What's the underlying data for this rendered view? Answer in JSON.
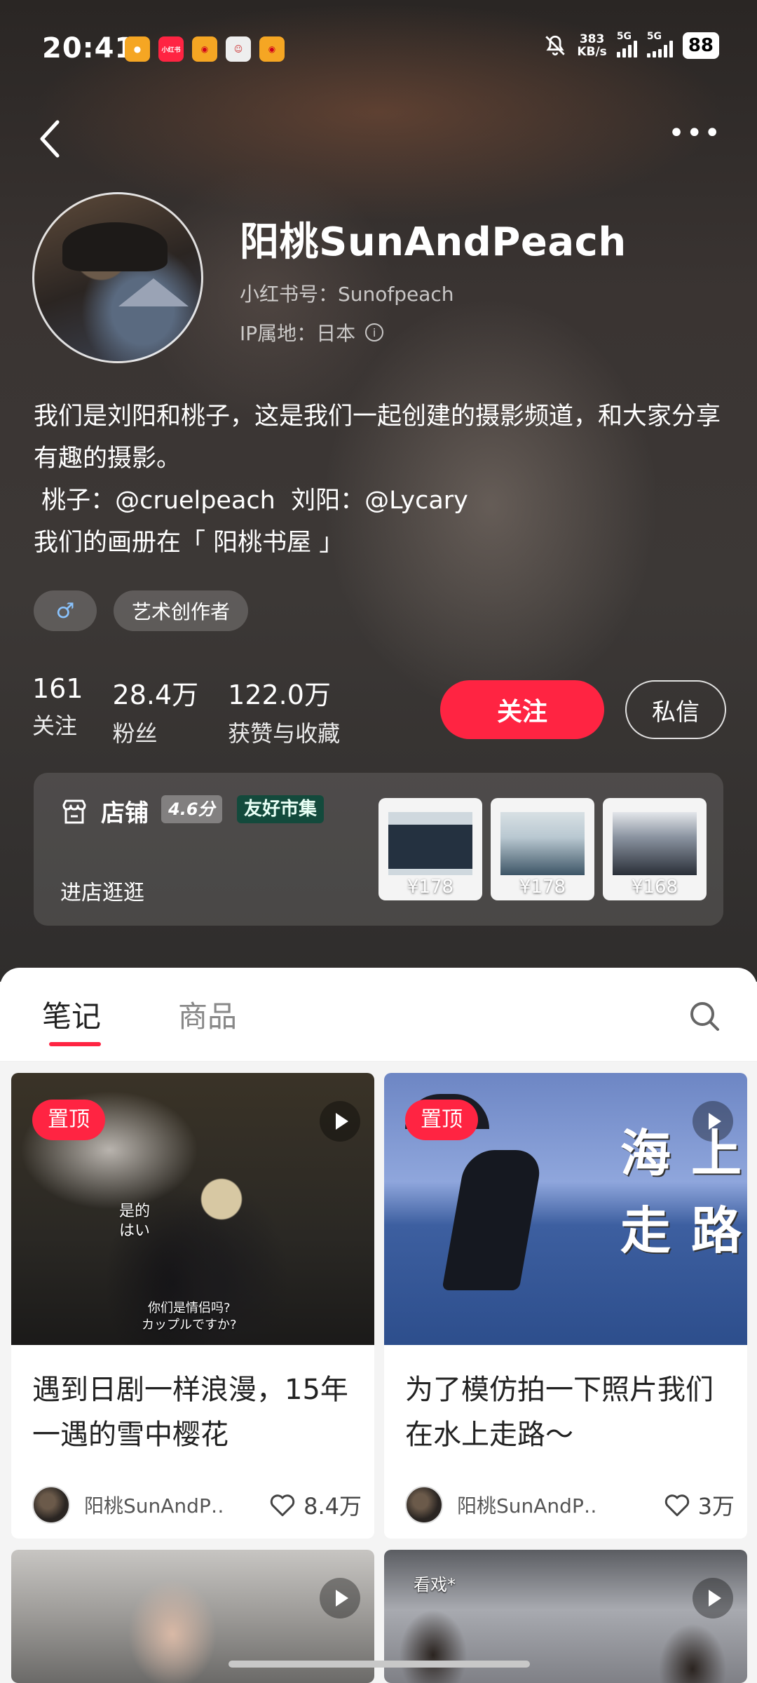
{
  "status_bar": {
    "time": "20:41",
    "net_speed_value": "383",
    "net_speed_unit": "KB/s",
    "sim1": "5G",
    "sim2": "5G",
    "battery": "88",
    "app_icons": [
      "notify-yellow-icon",
      "xiaohongshu-icon",
      "weibo-icon",
      "avatar-app-icon",
      "weibo-alt-icon"
    ],
    "xhs_label": "小红书"
  },
  "nav": {
    "back_icon": "back-chevron-icon",
    "more_icon": "more-dots-icon"
  },
  "profile": {
    "name": "阳桃SunAndPeach",
    "red_id": "小红书号：Sunofpeach",
    "ip": "IP属地：日本",
    "bio_lines": [
      "我们是刘阳和桃子，这是我们一起创建的摄影频道，和大家分享有趣的摄影。",
      " 桃子：@cruelpeach  刘阳：@Lycary",
      "我们的画册在「 阳桃书屋 」"
    ],
    "gender_symbol": "♂",
    "tag": "艺术创作者"
  },
  "stats": [
    {
      "num": "161",
      "label": "关注"
    },
    {
      "num": "28.4万",
      "label": "粉丝"
    },
    {
      "num": "122.0万",
      "label": "获赞与收藏"
    }
  ],
  "actions": {
    "follow": "关注",
    "message": "私信"
  },
  "shop": {
    "title": "店铺",
    "score": "4.6分",
    "badge": "友好市集",
    "link": "进店逛逛",
    "items": [
      {
        "price": "¥178"
      },
      {
        "price": "¥178"
      },
      {
        "price": "¥168"
      }
    ]
  },
  "tabs": {
    "notes": "笔记",
    "goods": "商品"
  },
  "cards": [
    {
      "pin": "置顶",
      "overlay_text_1": "是的",
      "overlay_text_2": "はい",
      "overlay_text_3": "你们是情侣吗?",
      "overlay_text_4": "カップルですか?",
      "title": "遇到日剧一样浪漫，15年一遇的雪中樱花",
      "author": "阳桃SunAndP…",
      "likes": "8.4万"
    },
    {
      "pin": "置顶",
      "overlay_text_1": "海 上",
      "overlay_text_2": "走 路",
      "title": "为了模仿拍一下照片我们在水上走路～",
      "author": "阳桃SunAndP…",
      "likes": "3万"
    },
    {
      "overlay_text_1": ""
    },
    {
      "overlay_text_1": "看戏*"
    }
  ],
  "colors": {
    "accent": "#ff2442",
    "badge_green": "#134a3c"
  }
}
